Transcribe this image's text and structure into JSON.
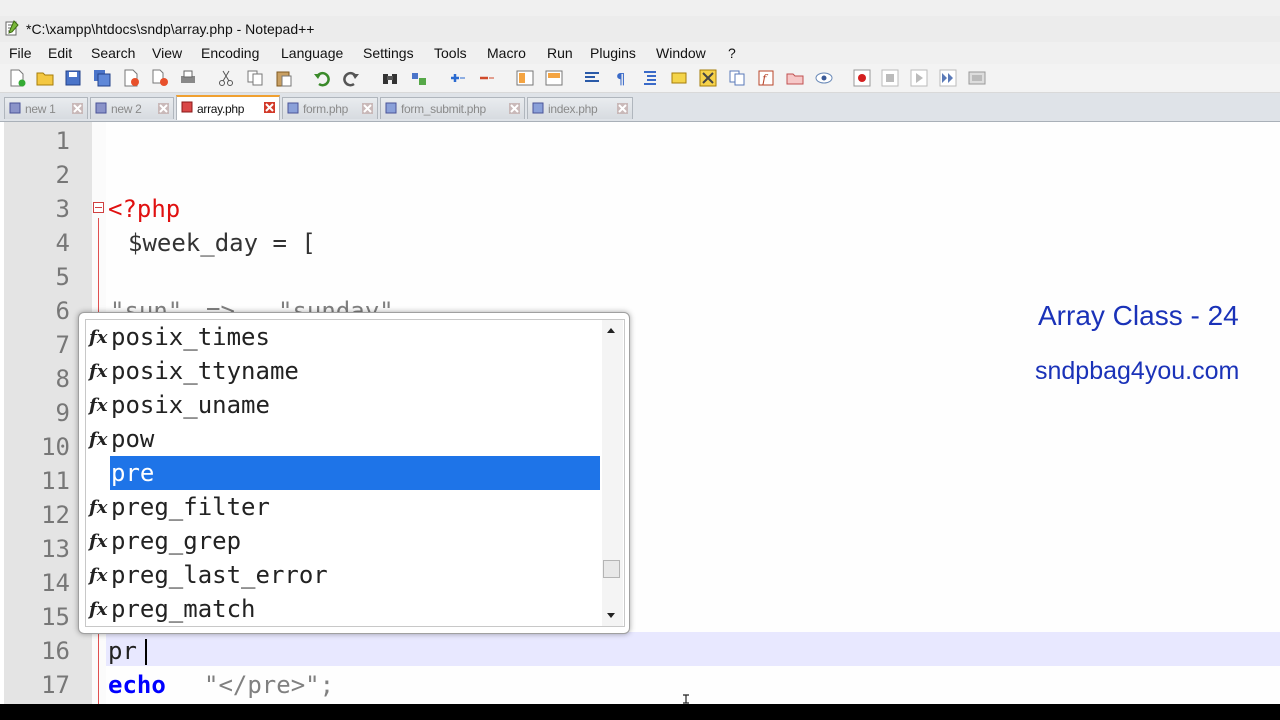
{
  "window": {
    "title": "*C:\\xampp\\htdocs\\sndp\\array.php - Notepad++"
  },
  "menu": [
    "File",
    "Edit",
    "Search",
    "View",
    "Encoding",
    "Language",
    "Settings",
    "Tools",
    "Macro",
    "Run",
    "Plugins",
    "Window",
    "?"
  ],
  "tabs": [
    {
      "label": "new 1",
      "active": false
    },
    {
      "label": "new 2",
      "active": false
    },
    {
      "label": "array.php",
      "active": true
    },
    {
      "label": "form.php",
      "active": false
    },
    {
      "label": "form_submit.php",
      "active": false
    },
    {
      "label": "index.php",
      "active": false
    }
  ],
  "editor": {
    "line_numbers": [
      "1",
      "2",
      "3",
      "4",
      "5",
      "6",
      "7",
      "8",
      "9",
      "10",
      "11",
      "12",
      "13",
      "14",
      "15",
      "16",
      "17"
    ],
    "lines": {
      "l3": "<?php",
      "l4": "$week_day = [",
      "l6a": "\"sun\"",
      "l6b": "=>",
      "l6c": "\"sunday\"",
      "l16": "pr",
      "l17a": "echo",
      "l17b": "\"</pre>\";"
    }
  },
  "autocomplete": {
    "items": [
      {
        "label": "posix_times",
        "icon": "function-icon",
        "selected": false
      },
      {
        "label": "posix_ttyname",
        "icon": "function-icon",
        "selected": false
      },
      {
        "label": "posix_uname",
        "icon": "function-icon",
        "selected": false
      },
      {
        "label": "pow",
        "icon": "function-icon",
        "selected": false
      },
      {
        "label": "pre",
        "icon": "",
        "selected": true
      },
      {
        "label": "preg_filter",
        "icon": "function-icon",
        "selected": false
      },
      {
        "label": "preg_grep",
        "icon": "function-icon",
        "selected": false
      },
      {
        "label": "preg_last_error",
        "icon": "function-icon",
        "selected": false
      },
      {
        "label": "preg_match",
        "icon": "function-icon",
        "selected": false
      }
    ],
    "fx_glyph": "fx"
  },
  "overlay": {
    "title": "Array Class - 24",
    "site": "sndpbag4you.com"
  },
  "colors": {
    "selection": "#1e74e8",
    "php_tag": "#ff0000",
    "keyword": "#0000ff",
    "string": "#808080",
    "overlay_text": "#1a32b8"
  }
}
